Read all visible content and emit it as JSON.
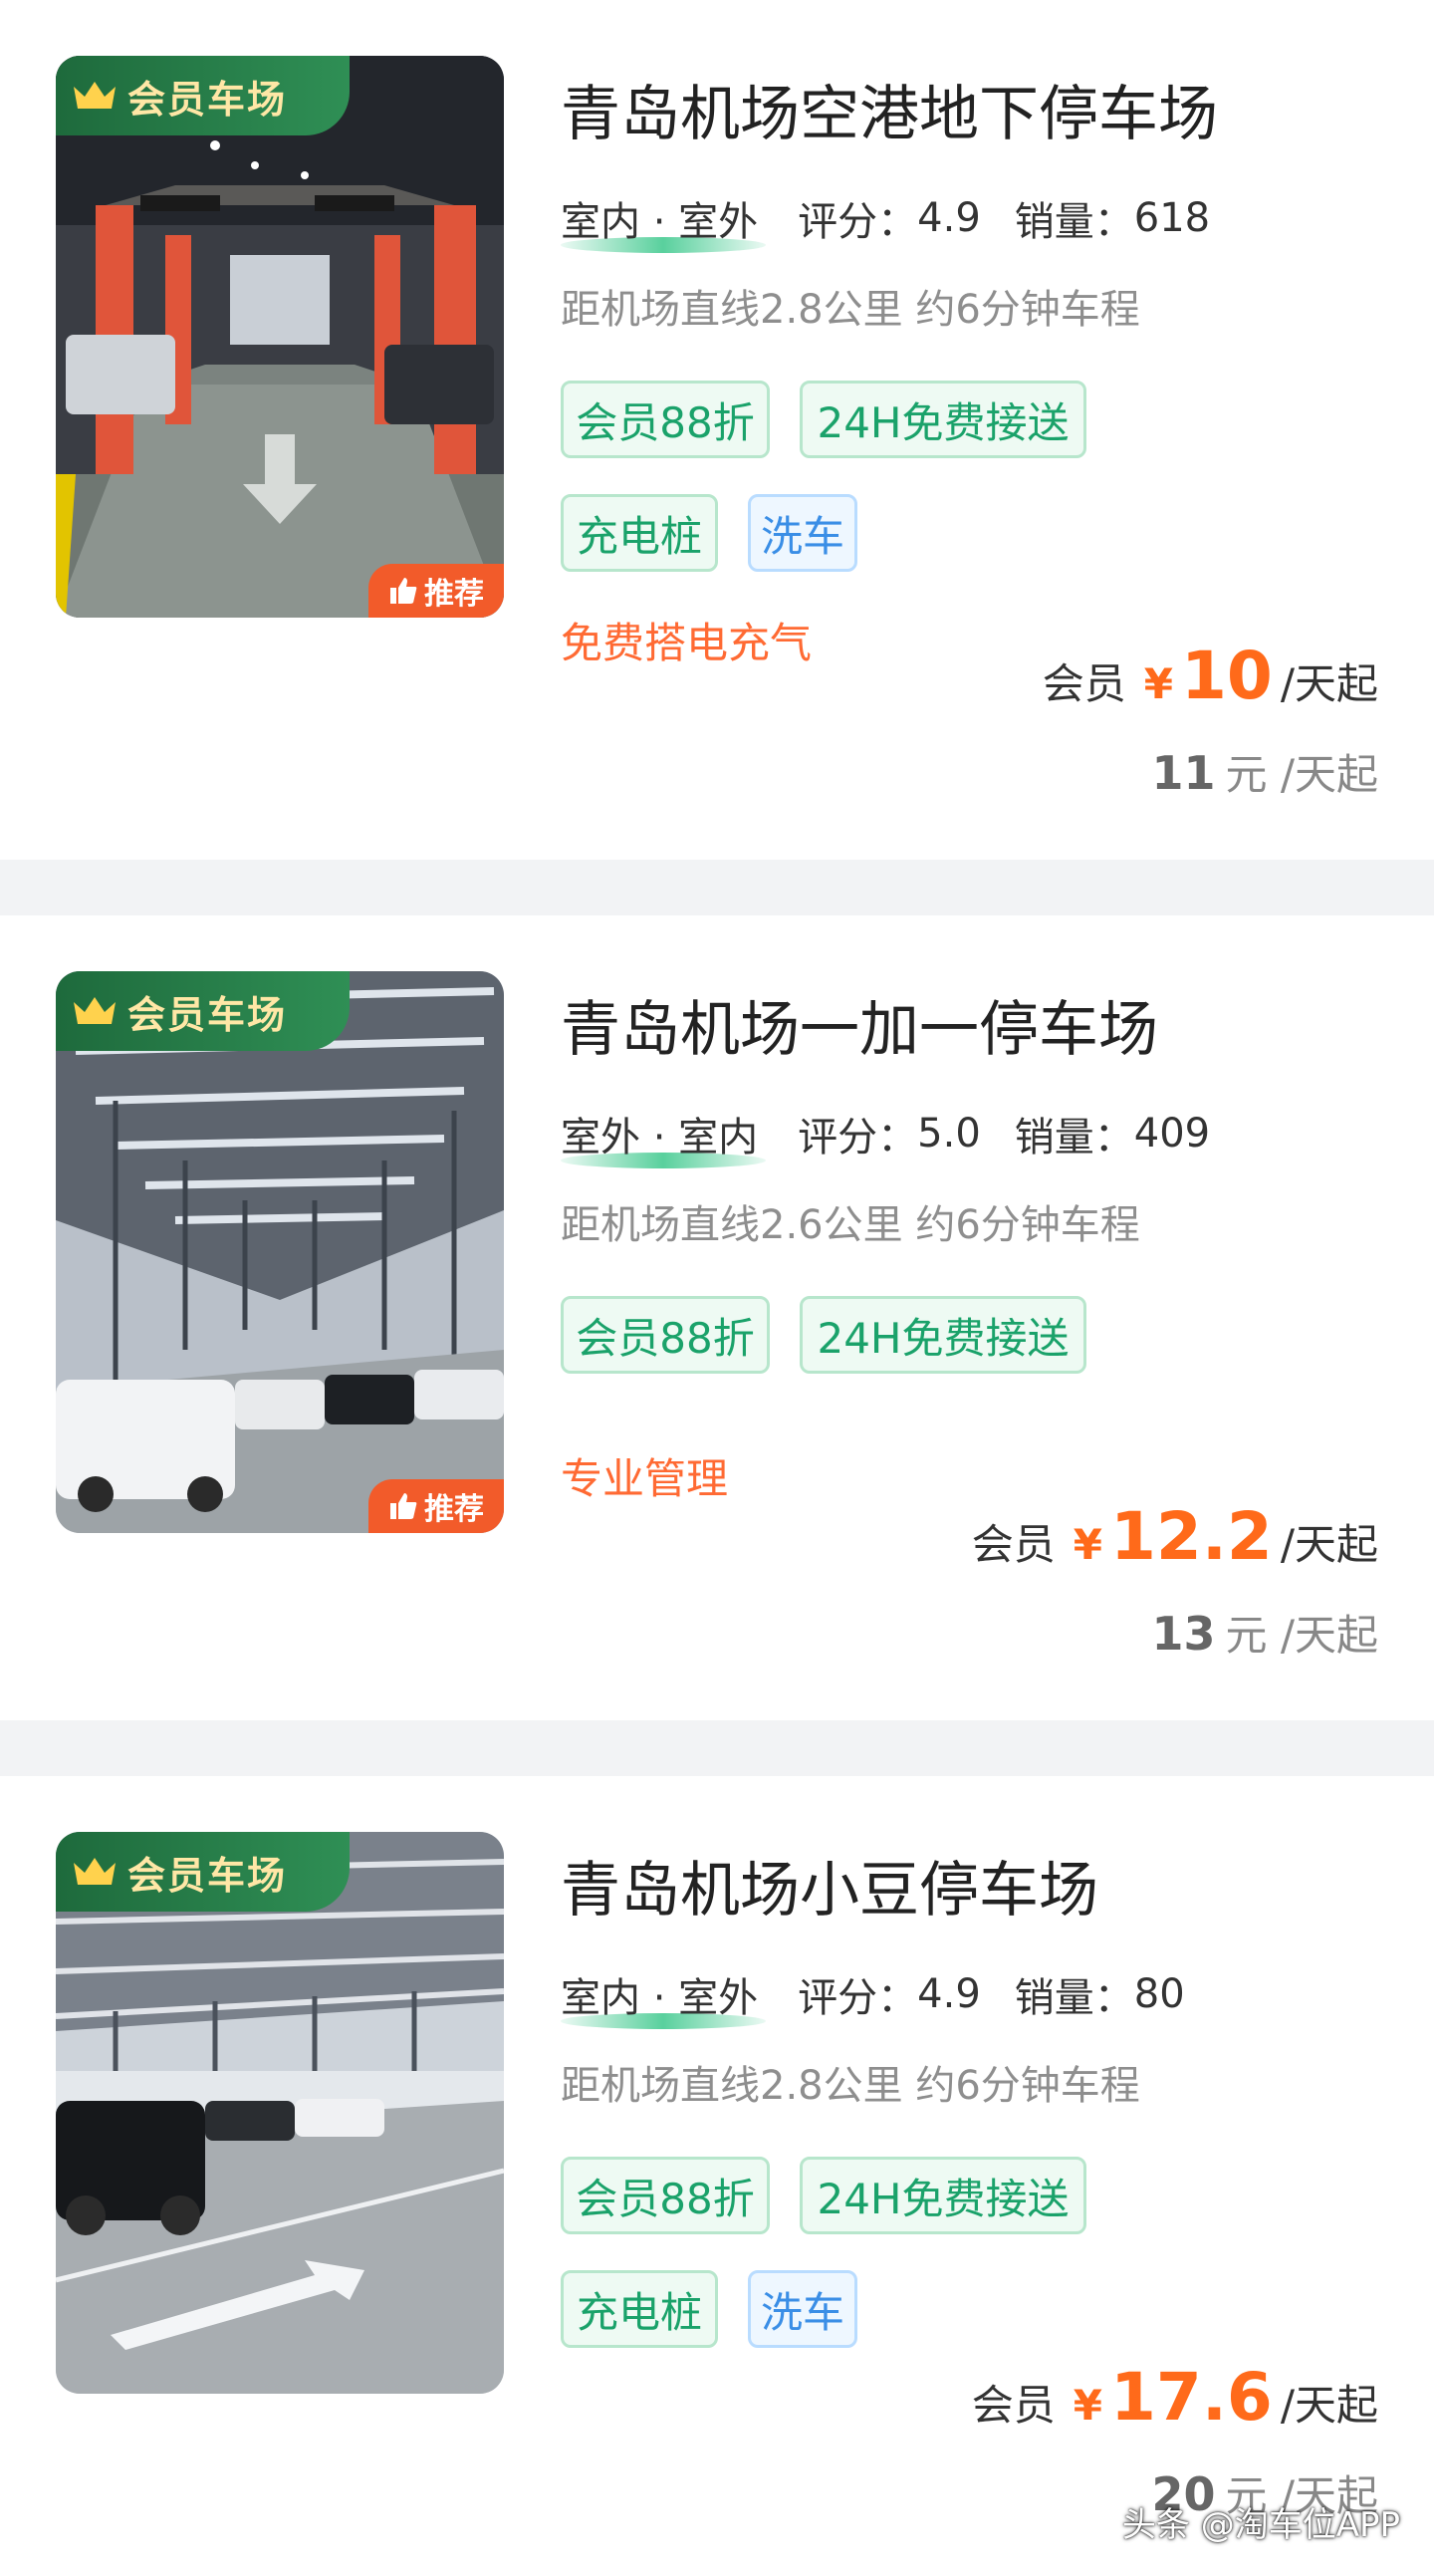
{
  "lots": [
    {
      "name": "青岛机场空港地下停车场",
      "member_tag": "会员车场",
      "recommend": "推荐",
      "type": "室内 · 室外",
      "rating_label": "评分：",
      "rating": "4.9",
      "sales_label": "销量：",
      "sales": "618",
      "distance": "距机场直线2.8公里 约6分钟车程",
      "tags_row1": [
        "会员88折",
        "24H免费接送"
      ],
      "tags_row2": [
        "充电桩",
        "洗车"
      ],
      "promo": "免费搭电充气",
      "member_label": "会员",
      "currency": "¥",
      "member_price": "10",
      "price_unit": "/天起",
      "orig_price": "11",
      "orig_unit": "元 /天起"
    },
    {
      "name": "青岛机场一加一停车场",
      "member_tag": "会员车场",
      "recommend": "推荐",
      "type": "室外 · 室内",
      "rating_label": "评分：",
      "rating": "5.0",
      "sales_label": "销量：",
      "sales": "409",
      "distance": "距机场直线2.6公里 约6分钟车程",
      "tags_row1": [
        "会员88折",
        "24H免费接送"
      ],
      "promo": "专业管理",
      "member_label": "会员",
      "currency": "¥",
      "member_price": "12.2",
      "price_unit": "/天起",
      "orig_price": "13",
      "orig_unit": "元 /天起"
    },
    {
      "name": "青岛机场小豆停车场",
      "member_tag": "会员车场",
      "type": "室内 · 室外",
      "rating_label": "评分：",
      "rating": "4.9",
      "sales_label": "销量：",
      "sales": "80",
      "distance": "距机场直线2.8公里 约6分钟车程",
      "tags_row1": [
        "会员88折",
        "24H免费接送"
      ],
      "tags_row2": [
        "充电桩",
        "洗车"
      ],
      "member_label": "会员",
      "currency": "¥",
      "member_price": "17.6",
      "price_unit": "/天起",
      "orig_price": "20",
      "orig_unit": "元 /天起"
    }
  ],
  "watermark": "头条 @淘车位APP",
  "colors": {
    "accent_orange": "#ff6a1a",
    "tag_green": "#1aa26a",
    "tag_blue": "#3a8ee6",
    "member_green": "#1e6a3c",
    "separator": "#f2f3f5"
  },
  "icons": [
    "crown-icon",
    "thumbs-up-icon"
  ]
}
